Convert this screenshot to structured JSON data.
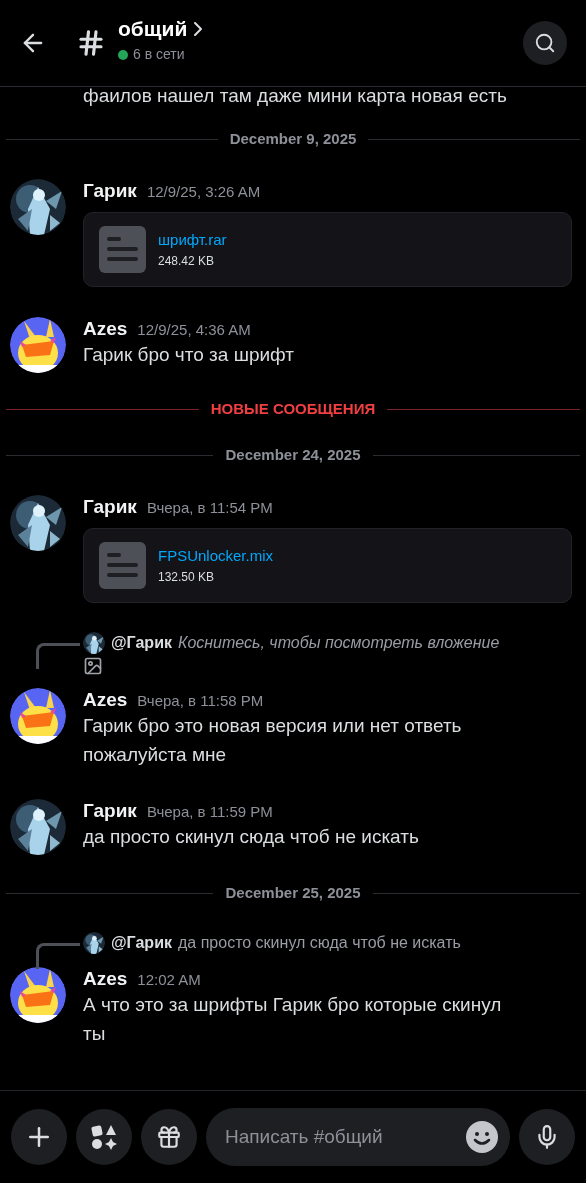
{
  "header": {
    "channel": "общий",
    "online": "6 в сети"
  },
  "feed": [
    {
      "kind": "fragment",
      "text": "фаилов нашел там даже мини карта новая есть"
    },
    {
      "kind": "date",
      "text": "December 9, 2025"
    },
    {
      "kind": "message",
      "avatar": {
        "kind": "figure"
      },
      "author": "Гарик",
      "time": "12/9/25, 3:26 AM",
      "file": {
        "name": "шрифт.rar",
        "size": "248.42 KB"
      }
    },
    {
      "kind": "message",
      "avatar": {
        "kind": "bunny"
      },
      "author": "Azes",
      "time": "12/9/25, 4:36 AM",
      "text": "Гарик бро что за шрифт"
    },
    {
      "kind": "new",
      "text": "НОВЫЕ СООБЩЕНИЯ"
    },
    {
      "kind": "date",
      "text": "December 24, 2025"
    },
    {
      "kind": "message",
      "avatar": {
        "kind": "figure"
      },
      "author": "Гарик",
      "time": "Вчера, в 11:54 PM",
      "file": {
        "name": "FPSUnlocker.mix",
        "size": "132.50 KB"
      }
    },
    {
      "kind": "message",
      "avatar": {
        "kind": "bunny"
      },
      "author": "Azes",
      "time": "Вчера, в 11:58 PM",
      "reply": {
        "kind": "attachment",
        "author": "@Гарик",
        "text": "Коснитесь, чтобы посмотреть вложение"
      },
      "text": "Гарик бро это новая версия или нет ответь пожалуйста мне"
    },
    {
      "kind": "message",
      "avatar": {
        "kind": "figure"
      },
      "author": "Гарик",
      "time": "Вчера, в 11:59 PM",
      "text": "да просто скинул сюда чтоб не искать"
    },
    {
      "kind": "date",
      "text": "December 25, 2025"
    },
    {
      "kind": "message",
      "avatar": {
        "kind": "bunny"
      },
      "author": "Azes",
      "time": "12:02 AM",
      "reply": {
        "kind": "text",
        "author": "@Гарик",
        "text": "да просто скинул сюда чтоб не искать"
      },
      "text": "А что это за шрифты Гарик бро которые скинул ты"
    }
  ],
  "composer": {
    "placeholder": "Написать #общий"
  }
}
